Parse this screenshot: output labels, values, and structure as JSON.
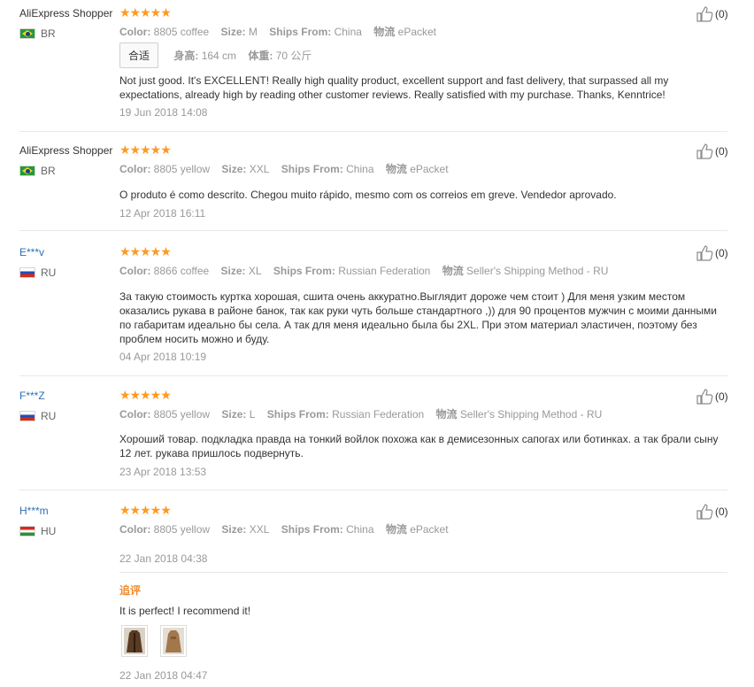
{
  "reviews": [
    {
      "user": "AliExpress Shopper",
      "country": "BR",
      "flag": "br",
      "rating_stars": 5,
      "attrs": [
        {
          "k": "Color:",
          "v": "8805 coffee"
        },
        {
          "k": "Size:",
          "v": "M"
        },
        {
          "k": "Ships From:",
          "v": "China"
        },
        {
          "k": "物流",
          "v": "ePacket"
        }
      ],
      "fit_label": "合适",
      "height_label": "身高:",
      "height_value": "164 cm",
      "weight_label": "体重:",
      "weight_value": "70 公斤",
      "text": "Not just good. It's EXCELLENT! Really high quality product, excellent support and fast delivery, that surpassed all my expectations, already high by reading other customer reviews. Really satisfied with my purchase. Thanks, Kenntrice!",
      "date": "19 Jun 2018 14:08",
      "helpful": "(0)"
    },
    {
      "user": "AliExpress Shopper",
      "country": "BR",
      "flag": "br",
      "rating_stars": 5,
      "attrs": [
        {
          "k": "Color:",
          "v": "8805 yellow"
        },
        {
          "k": "Size:",
          "v": "XXL"
        },
        {
          "k": "Ships From:",
          "v": "China"
        },
        {
          "k": "物流",
          "v": "ePacket"
        }
      ],
      "text": "O produto é como descrito. Chegou muito rápido, mesmo com os correios em greve. Vendedor aprovado.",
      "date": "12 Apr 2018 16:11",
      "helpful": "(0)"
    },
    {
      "user": "E***v",
      "country": "RU",
      "flag": "ru",
      "rating_stars": 5,
      "attrs": [
        {
          "k": "Color:",
          "v": "8866 coffee"
        },
        {
          "k": "Size:",
          "v": "XL"
        },
        {
          "k": "Ships From:",
          "v": "Russian Federation"
        },
        {
          "k": "物流",
          "v": "Seller's Shipping Method - RU"
        }
      ],
      "text": "За такую стоимость куртка хорошая, сшита очень аккуратно.Выглядит дороже чем стоит ) Для меня узким местом оказались рукава в районе банок, так как руки чуть больше стандартного ,)) для 90 процентов мужчин с моими данными по габаритам идеально бы села. А так для меня идеально была бы 2XL. При этом материал эластичен, поэтому без проблем носить можно и буду.",
      "date": "04 Apr 2018 10:19",
      "helpful": "(0)"
    },
    {
      "user": "F***Z",
      "country": "RU",
      "flag": "ru",
      "rating_stars": 5,
      "attrs": [
        {
          "k": "Color:",
          "v": "8805 yellow"
        },
        {
          "k": "Size:",
          "v": "L"
        },
        {
          "k": "Ships From:",
          "v": "Russian Federation"
        },
        {
          "k": "物流",
          "v": "Seller's Shipping Method - RU"
        }
      ],
      "text": "Хороший товар. подкладка правда на тонкий войлок похожа как в демисезонных сапогах или ботинках. а так брали сыну 12 лет. рукава пришлось подвернуть.",
      "date": "23 Apr 2018 13:53",
      "helpful": "(0)"
    },
    {
      "user": "H***m",
      "country": "HU",
      "flag": "hu",
      "rating_stars": 5,
      "attrs": [
        {
          "k": "Color:",
          "v": "8805 yellow"
        },
        {
          "k": "Size:",
          "v": "XXL"
        },
        {
          "k": "Ships From:",
          "v": "China"
        },
        {
          "k": "物流",
          "v": "ePacket"
        }
      ],
      "date": "22 Jan 2018 04:38",
      "helpful": "(0)",
      "additional_label": "追评",
      "additional_text": "It is perfect! I recommend it!",
      "additional_date": "22 Jan 2018 04:47"
    }
  ],
  "colors": {
    "star": "#ff9a1f",
    "link_user": "#2f6fb4",
    "additional_label": "#f0892b",
    "muted": "#999999"
  }
}
